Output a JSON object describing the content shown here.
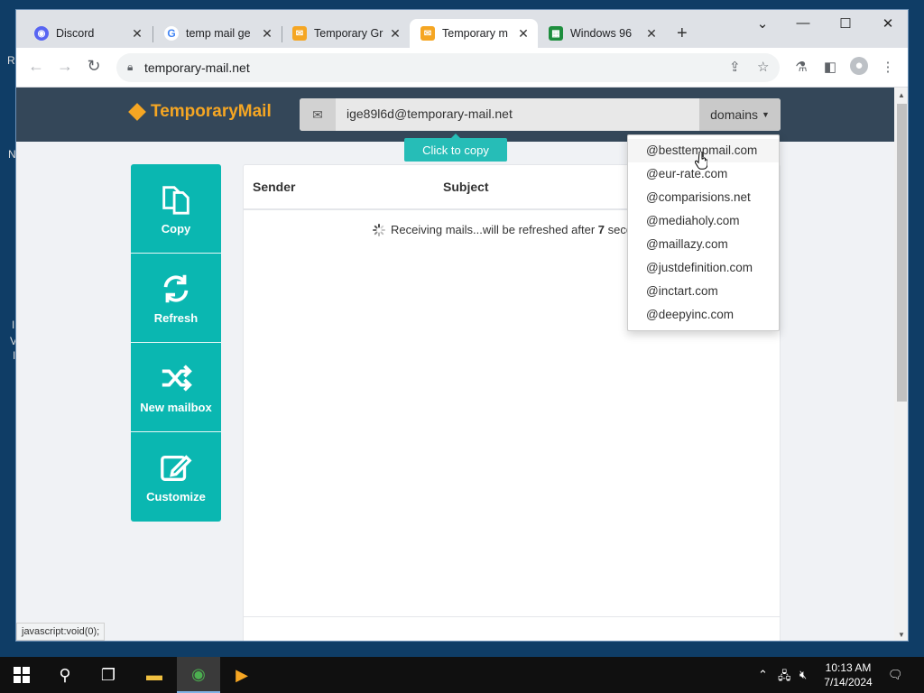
{
  "desktop": {
    "letters": [
      "R",
      "N",
      "I",
      "V",
      "I"
    ]
  },
  "tabs": [
    {
      "label": "Discord",
      "icon": "discord-icon",
      "color": "#5865f2"
    },
    {
      "label": "temp mail ge",
      "icon": "google-icon",
      "color": "#4285f4"
    },
    {
      "label": "Temporary Gr",
      "icon": "mail-icon",
      "color": "#f5a623"
    },
    {
      "label": "Temporary m",
      "icon": "mail-icon",
      "color": "#f5a623",
      "active": true
    },
    {
      "label": "Windows 96",
      "icon": "windows96-icon",
      "color": "#1e8e3e"
    }
  ],
  "address_bar": {
    "url": "temporary-mail.net"
  },
  "site": {
    "logo_text": "TemporaryMail",
    "email": "ige89l6d@temporary-mail.net",
    "domains_label": "domains",
    "tooltip": "Click to copy",
    "actions": [
      {
        "label": "Copy",
        "icon": "copy-icon"
      },
      {
        "label": "Refresh",
        "icon": "refresh-icon"
      },
      {
        "label": "New mailbox",
        "icon": "shuffle-icon"
      },
      {
        "label": "Customize",
        "icon": "edit-icon"
      }
    ],
    "table": {
      "sender_header": "Sender",
      "subject_header": "Subject"
    },
    "status": {
      "prefix": "Receiving mails...will be refreshed after",
      "seconds": "7",
      "suffix": "seco"
    }
  },
  "domains": [
    "@besttempmail.com",
    "@eur-rate.com",
    "@comparisions.net",
    "@mediaholy.com",
    "@maillazy.com",
    "@justdefinition.com",
    "@inctart.com",
    "@deepyinc.com"
  ],
  "statusbar": "javascript:void(0);",
  "clock": {
    "time": "10:13 AM",
    "date": "7/14/2024"
  },
  "colors": {
    "accent": "#0ab7b1",
    "header": "#344759",
    "logo": "#f5a623"
  }
}
